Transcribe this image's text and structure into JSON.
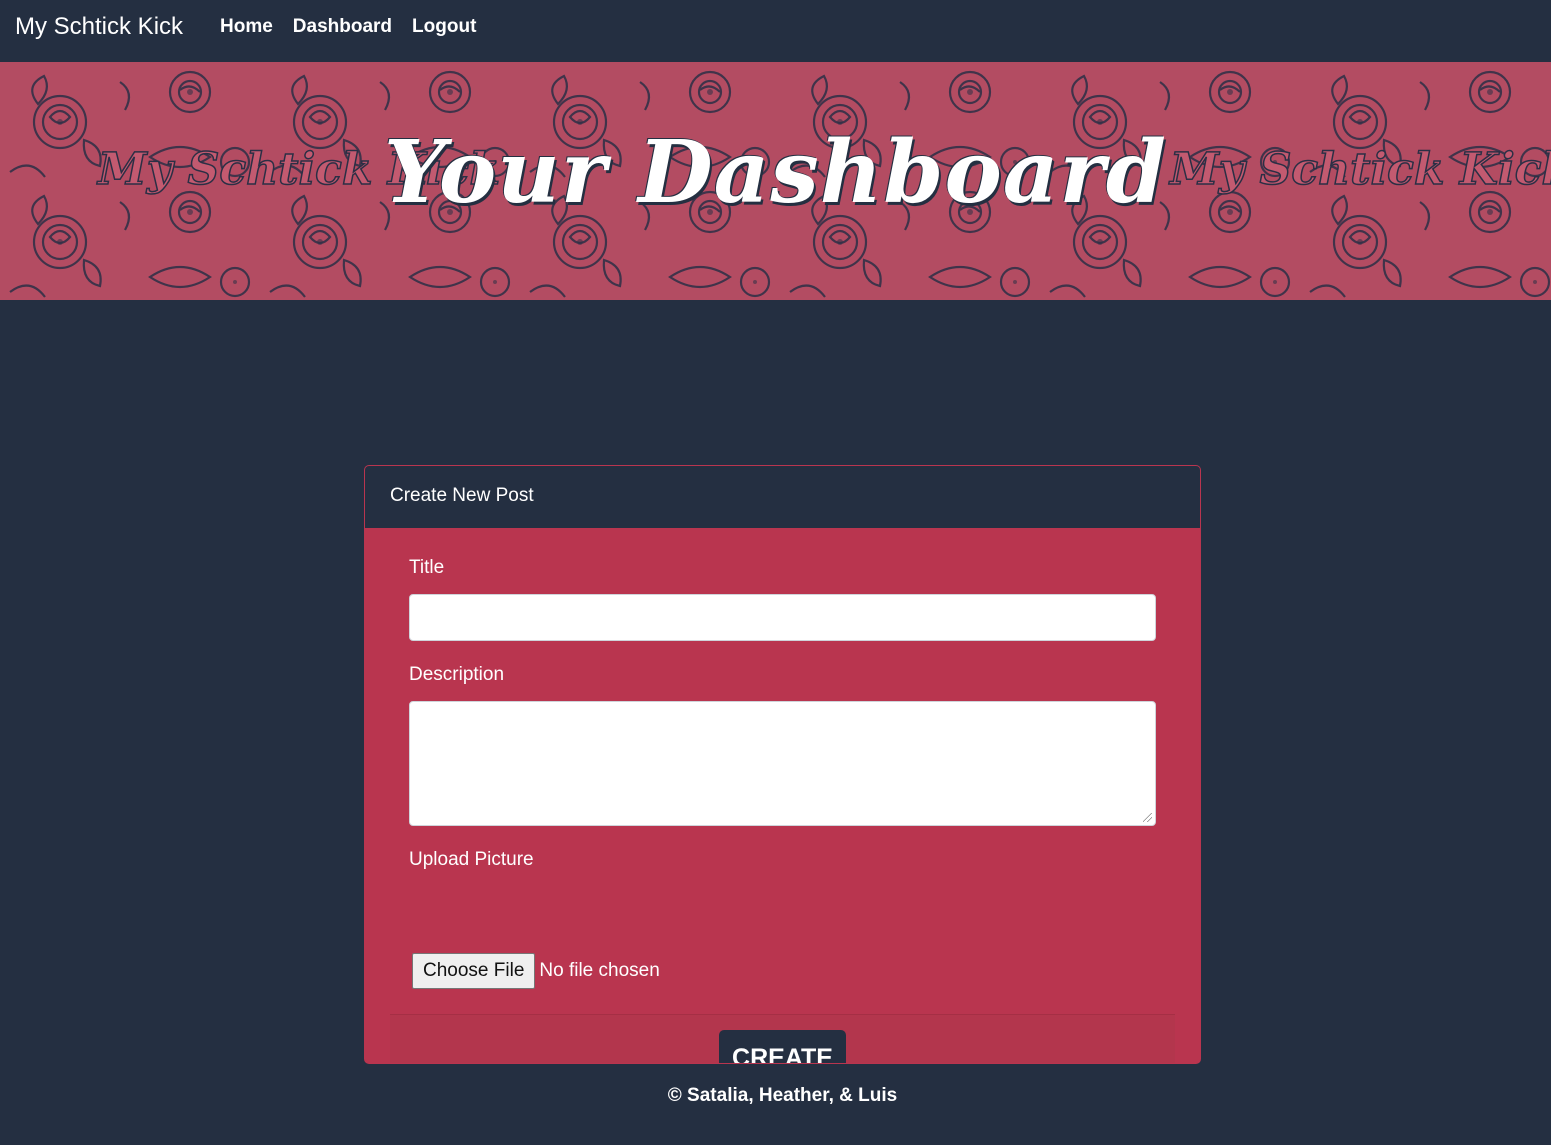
{
  "navbar": {
    "brand": "My Schtick Kick",
    "links": [
      {
        "label": "Home"
      },
      {
        "label": "Dashboard"
      },
      {
        "label": "Logout"
      }
    ]
  },
  "hero": {
    "title": "Your Dashboard",
    "watermark": "My Schtick Kick"
  },
  "form": {
    "header": "Create New Post",
    "title_label": "Title",
    "title_value": "",
    "description_label": "Description",
    "description_value": "",
    "upload_label": "Upload Picture",
    "file_button_label": "Choose File",
    "file_status": "No file chosen",
    "submit_label": "CREATE"
  },
  "footer": {
    "text": "© Satalia, Heather, & Luis"
  },
  "colors": {
    "page_background": "#242f41",
    "hero_background": "#b34c62",
    "card_background": "#b9354f",
    "button_background": "#242f41"
  },
  "icons": [
    "rose-pattern"
  ]
}
